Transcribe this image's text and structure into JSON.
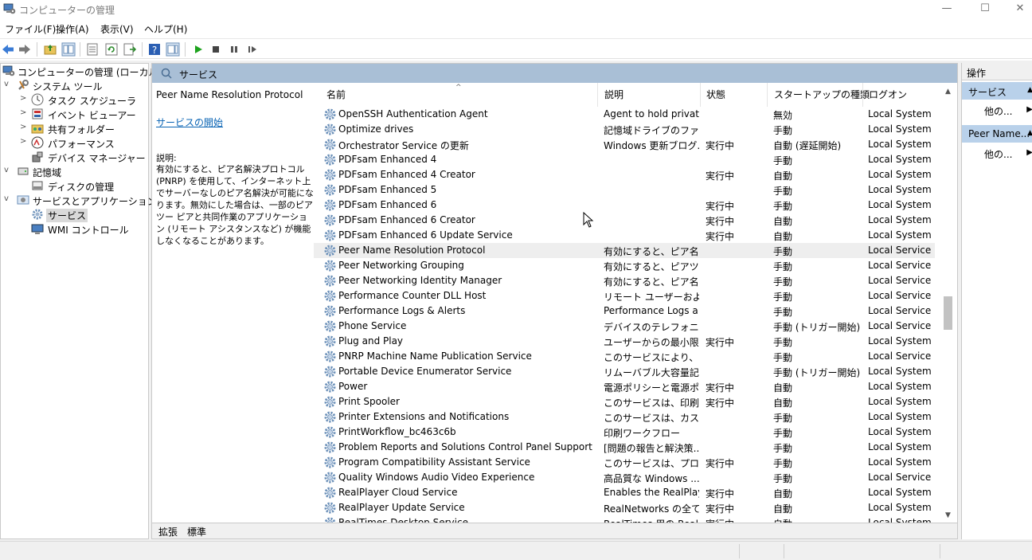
{
  "window": {
    "title": "コンピューターの管理",
    "minimize": "—",
    "maximize": "☐",
    "close": "✕"
  },
  "menu": [
    "ファイル(F)",
    "操作(A)",
    "表示(V)",
    "ヘルプ(H)"
  ],
  "tree": [
    {
      "label": "コンピューターの管理 (ローカル)",
      "icon": "computer-management-icon",
      "expander": ""
    },
    {
      "label": "システム ツール",
      "icon": "system-tools-icon",
      "expander": "v"
    },
    {
      "label": "タスク スケジューラ",
      "icon": "clock-icon",
      "expander": ">"
    },
    {
      "label": "イベント ビューアー",
      "icon": "event-viewer-icon",
      "expander": ">"
    },
    {
      "label": "共有フォルダー",
      "icon": "shared-folder-icon",
      "expander": ">"
    },
    {
      "label": "パフォーマンス",
      "icon": "performance-icon",
      "expander": ">"
    },
    {
      "label": "デバイス マネージャー",
      "icon": "device-manager-icon",
      "expander": ""
    },
    {
      "label": "記憶域",
      "icon": "storage-icon",
      "expander": "v"
    },
    {
      "label": "ディスクの管理",
      "icon": "disk-management-icon",
      "expander": ""
    },
    {
      "label": "サービスとアプリケーション",
      "icon": "services-apps-icon",
      "expander": "v"
    },
    {
      "label": "サービス",
      "icon": "gear-icon",
      "expander": ""
    },
    {
      "label": "WMI コントロール",
      "icon": "wmi-icon",
      "expander": ""
    }
  ],
  "center": {
    "header": "サービス",
    "selected_service": "Peer Name Resolution Protocol",
    "start_link": "サービスの開始",
    "desc_label": "説明:",
    "desc_text": "有効にすると、ピア名解決プロトコル (PNRP) を使用して、インターネット上でサーバーなしのピア名解決が可能になります。無効にした場合は、一部のピア ツー ピアと共同作業のアプリケーション (リモート アシスタンスなど) が機能しなくなることがあります。"
  },
  "columns": {
    "name": "名前",
    "description": "説明",
    "status": "状態",
    "startup": "スタートアップの種類",
    "logon": "ログオン"
  },
  "services": [
    {
      "name": "OpenSSH Authentication Agent",
      "description": "Agent to hold privat...",
      "status": "",
      "startup": "無効",
      "logon": "Local System"
    },
    {
      "name": "Optimize drives",
      "description": "記憶域ドライブのファイ...",
      "status": "",
      "startup": "手動",
      "logon": "Local System"
    },
    {
      "name": "Orchestrator Service の更新",
      "description": "Windows 更新ブログ...",
      "status": "実行中",
      "startup": "自動 (遅延開始)",
      "logon": "Local System"
    },
    {
      "name": "PDFsam Enhanced 4",
      "description": "",
      "status": "",
      "startup": "手動",
      "logon": "Local System"
    },
    {
      "name": "PDFsam Enhanced 4 Creator",
      "description": "",
      "status": "実行中",
      "startup": "自動",
      "logon": "Local System"
    },
    {
      "name": "PDFsam Enhanced 5",
      "description": "",
      "status": "",
      "startup": "手動",
      "logon": "Local System"
    },
    {
      "name": "PDFsam Enhanced 6",
      "description": "",
      "status": "実行中",
      "startup": "手動",
      "logon": "Local System"
    },
    {
      "name": "PDFsam Enhanced 6 Creator",
      "description": "",
      "status": "実行中",
      "startup": "自動",
      "logon": "Local System"
    },
    {
      "name": "PDFsam Enhanced 6 Update Service",
      "description": "",
      "status": "実行中",
      "startup": "自動",
      "logon": "Local System"
    },
    {
      "name": "Peer Name Resolution Protocol",
      "description": "有効にすると、ピア名...",
      "status": "",
      "startup": "手動",
      "logon": "Local Service"
    },
    {
      "name": "Peer Networking Grouping",
      "description": "有効にすると、ピアツー...",
      "status": "",
      "startup": "手動",
      "logon": "Local Service"
    },
    {
      "name": "Peer Networking Identity Manager",
      "description": "有効にすると、ピア名...",
      "status": "",
      "startup": "手動",
      "logon": "Local Service"
    },
    {
      "name": "Performance Counter DLL Host",
      "description": "リモート ユーザーおよび ...",
      "status": "",
      "startup": "手動",
      "logon": "Local Service"
    },
    {
      "name": "Performance Logs & Alerts",
      "description": "Performance Logs a...",
      "status": "",
      "startup": "手動",
      "logon": "Local Service"
    },
    {
      "name": "Phone Service",
      "description": "デバイスのテレフォニー...",
      "status": "",
      "startup": "手動 (トリガー開始)",
      "logon": "Local Service"
    },
    {
      "name": "Plug and Play",
      "description": "ユーザーからの最小限...",
      "status": "実行中",
      "startup": "手動",
      "logon": "Local System"
    },
    {
      "name": "PNRP Machine Name Publication Service",
      "description": "このサービスにより、ピア...",
      "status": "",
      "startup": "手動",
      "logon": "Local Service"
    },
    {
      "name": "Portable Device Enumerator Service",
      "description": "リムーバブル大容量記...",
      "status": "",
      "startup": "手動 (トリガー開始)",
      "logon": "Local System"
    },
    {
      "name": "Power",
      "description": "電源ポリシーと電源ポ...",
      "status": "実行中",
      "startup": "自動",
      "logon": "Local System"
    },
    {
      "name": "Print Spooler",
      "description": "このサービスは、印刷ジ...",
      "status": "実行中",
      "startup": "自動",
      "logon": "Local System"
    },
    {
      "name": "Printer Extensions and Notifications",
      "description": "このサービスは、カスタム...",
      "status": "",
      "startup": "手動",
      "logon": "Local System"
    },
    {
      "name": "PrintWorkflow_bc463c6b",
      "description": "印刷ワークフロー",
      "status": "",
      "startup": "手動",
      "logon": "Local System"
    },
    {
      "name": "Problem Reports and Solutions Control Panel Support",
      "description": "[問題の報告と解決策...",
      "status": "",
      "startup": "手動",
      "logon": "Local System"
    },
    {
      "name": "Program Compatibility Assistant Service",
      "description": "このサービスは、プログラ...",
      "status": "実行中",
      "startup": "手動",
      "logon": "Local System"
    },
    {
      "name": "Quality Windows Audio Video Experience",
      "description": "高品質な Windows ...",
      "status": "",
      "startup": "手動",
      "logon": "Local Service"
    },
    {
      "name": "RealPlayer Cloud Service",
      "description": "Enables the RealPlay...",
      "status": "実行中",
      "startup": "自動",
      "logon": "Local System"
    },
    {
      "name": "RealPlayer Update Service",
      "description": "RealNetworks の全て...",
      "status": "実行中",
      "startup": "自動",
      "logon": "Local System"
    },
    {
      "name": "RealTimes Desktop Service",
      "description": "RealTimes 用の Real...",
      "status": "実行中",
      "startup": "自動",
      "logon": "Local System"
    }
  ],
  "tabs": [
    "拡張",
    "標準"
  ],
  "actions": {
    "header": "操作",
    "section1": "サービス",
    "section1_more": "他の...",
    "section2": "Peer Name...",
    "section2_more": "他の..."
  },
  "colors": {
    "header_blue": "#a9bfd6",
    "action_section": "#b9d1ea",
    "link": "#0a64b4"
  }
}
